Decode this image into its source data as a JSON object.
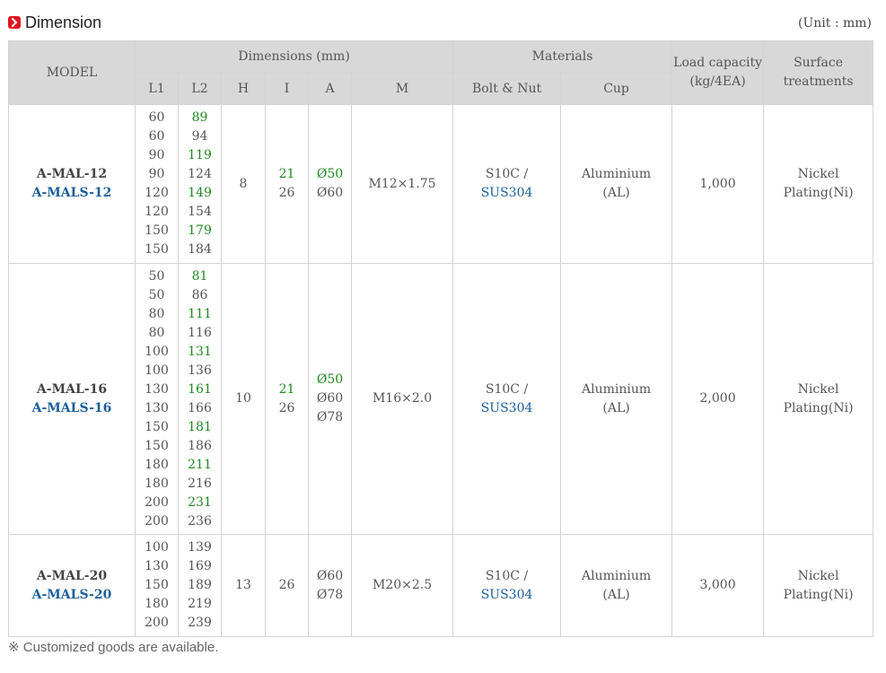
{
  "title": "Dimension",
  "unit_note": "(Unit : mm)",
  "header": {
    "model": "MODEL",
    "dimensions": "Dimensions (mm)",
    "materials": "Materials",
    "load": "Load capacity (kg/4EA)",
    "surface": "Surface treatments",
    "l1": "L1",
    "l2": "L2",
    "h": "H",
    "i": "I",
    "a": "A",
    "m": "M",
    "bolt_nut": "Bolt & Nut",
    "cup": "Cup"
  },
  "rows": [
    {
      "model": "A-MAL-12",
      "model_s": "A-MALS-12",
      "l1": [
        "60",
        "60",
        "90",
        "90",
        "120",
        "120",
        "150",
        "150"
      ],
      "l2": [
        {
          "v": "89",
          "g": true
        },
        {
          "v": "94",
          "g": false
        },
        {
          "v": "119",
          "g": true
        },
        {
          "v": "124",
          "g": false
        },
        {
          "v": "149",
          "g": true
        },
        {
          "v": "154",
          "g": false
        },
        {
          "v": "179",
          "g": true
        },
        {
          "v": "184",
          "g": false
        }
      ],
      "h": "8",
      "i": [
        {
          "v": "21",
          "g": true
        },
        {
          "v": "26",
          "g": false
        }
      ],
      "a": [
        {
          "v": "Ø50",
          "g": true
        },
        {
          "v": "Ø60",
          "g": false
        }
      ],
      "m": "M12×1.75",
      "bolt": "S10C /",
      "bolt_s": "SUS304",
      "cup": "Aluminium",
      "cup2": "(AL)",
      "load": "1,000",
      "surface": "Nickel",
      "surface2": "Plating(Ni)"
    },
    {
      "model": "A-MAL-16",
      "model_s": "A-MALS-16",
      "l1": [
        "50",
        "50",
        "80",
        "80",
        "100",
        "100",
        "130",
        "130",
        "150",
        "150",
        "180",
        "180",
        "200",
        "200"
      ],
      "l2": [
        {
          "v": "81",
          "g": true
        },
        {
          "v": "86",
          "g": false
        },
        {
          "v": "111",
          "g": true
        },
        {
          "v": "116",
          "g": false
        },
        {
          "v": "131",
          "g": true
        },
        {
          "v": "136",
          "g": false
        },
        {
          "v": "161",
          "g": true
        },
        {
          "v": "166",
          "g": false
        },
        {
          "v": "181",
          "g": true
        },
        {
          "v": "186",
          "g": false
        },
        {
          "v": "211",
          "g": true
        },
        {
          "v": "216",
          "g": false
        },
        {
          "v": "231",
          "g": true
        },
        {
          "v": "236",
          "g": false
        }
      ],
      "h": "10",
      "i": [
        {
          "v": "21",
          "g": true
        },
        {
          "v": "26",
          "g": false
        }
      ],
      "a": [
        {
          "v": "Ø50",
          "g": true
        },
        {
          "v": "Ø60",
          "g": false
        },
        {
          "v": "Ø78",
          "g": false
        }
      ],
      "m": "M16×2.0",
      "bolt": "S10C /",
      "bolt_s": "SUS304",
      "cup": "Aluminium",
      "cup2": "(AL)",
      "load": "2,000",
      "surface": "Nickel",
      "surface2": "Plating(Ni)"
    },
    {
      "model": "A-MAL-20",
      "model_s": "A-MALS-20",
      "l1": [
        "100",
        "130",
        "150",
        "180",
        "200"
      ],
      "l2": [
        {
          "v": "139",
          "g": false
        },
        {
          "v": "169",
          "g": false
        },
        {
          "v": "189",
          "g": false
        },
        {
          "v": "219",
          "g": false
        },
        {
          "v": "239",
          "g": false
        }
      ],
      "h": "13",
      "i": [
        {
          "v": "26",
          "g": false
        }
      ],
      "a": [
        {
          "v": "Ø60",
          "g": false
        },
        {
          "v": "Ø78",
          "g": false
        }
      ],
      "m": "M20×2.5",
      "bolt": "S10C /",
      "bolt_s": "SUS304",
      "cup": "Aluminium",
      "cup2": "(AL)",
      "load": "3,000",
      "surface": "Nickel",
      "surface2": "Plating(Ni)"
    }
  ],
  "footnote": "※ Customized goods are available.",
  "colors": {
    "accent_red": "#e0141e",
    "blue": "#1a5f9c",
    "green": "#1f8a1f",
    "header_bg": "#d8d8d8",
    "border": "#d3d3d3"
  },
  "icons": {
    "title_icon": "chevron-right-icon"
  }
}
